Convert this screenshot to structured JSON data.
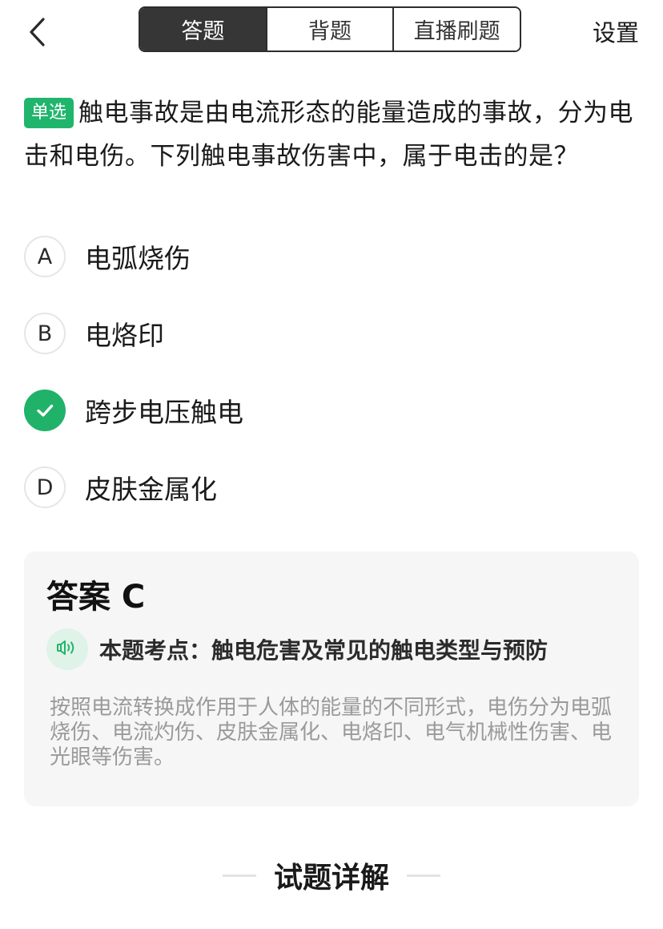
{
  "header": {
    "tabs": [
      {
        "label": "答题",
        "active": true
      },
      {
        "label": "背题",
        "active": false
      },
      {
        "label": "直播刷题",
        "active": false
      }
    ],
    "settings_label": "设置",
    "back_icon": "chevron-left-icon"
  },
  "question": {
    "type_badge": "单选",
    "text": "触电事故是由电流形态的能量造成的事故，分为电击和电伤。下列触电事故伤害中，属于电击的是？",
    "options": [
      {
        "letter": "A",
        "text": "电弧烧伤",
        "correct": false
      },
      {
        "letter": "B",
        "text": "电烙印",
        "correct": false
      },
      {
        "letter": "C",
        "text": "跨步电压触电",
        "correct": true
      },
      {
        "letter": "D",
        "text": "皮肤金属化",
        "correct": false
      }
    ]
  },
  "answer": {
    "title": "答案 C",
    "sound_icon": "speaker-icon",
    "point_label": "本题考点：触电危害及常见的触电类型与预防",
    "analysis": "按照电流转换成作用于人体的能量的不同形式，电伤分为电弧烧伤、电流灼伤、皮肤金属化、电烙印、电气机械性伤害、电光眼等伤害。"
  },
  "detail": {
    "title": "试题详解"
  },
  "colors": {
    "accent_green": "#20b56c",
    "active_tab_bg": "#363636",
    "card_bg": "#f6f6f6",
    "muted_text": "#9a9a9a"
  }
}
